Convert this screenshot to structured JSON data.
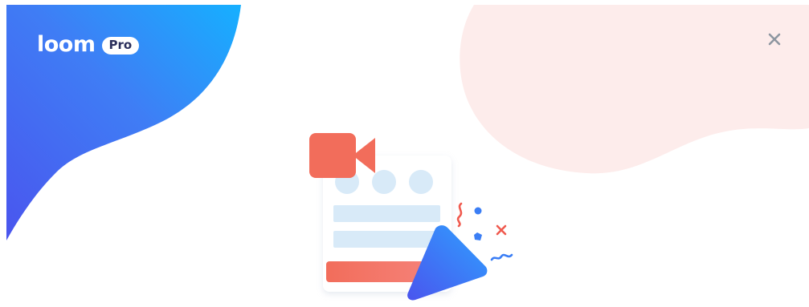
{
  "brand": {
    "name": "loom",
    "plan_badge": "Pro"
  },
  "dialog": {
    "close_icon": "close-icon"
  },
  "colors": {
    "blue_gradient_start": "#4a5cf0",
    "blue_gradient_end": "#1aa8ff",
    "peach_blob": "#fdeceb",
    "camera_red": "#f26d5b",
    "doc_light_blue": "#dcecf8",
    "confetti_blue": "#3b7ef5",
    "confetti_red": "#f05a4f"
  },
  "illustration": {
    "camera_icon": "video-camera-icon",
    "play_icon": "play-icon",
    "document_icon": "document-icon",
    "confetti_icon": "confetti-icon"
  }
}
